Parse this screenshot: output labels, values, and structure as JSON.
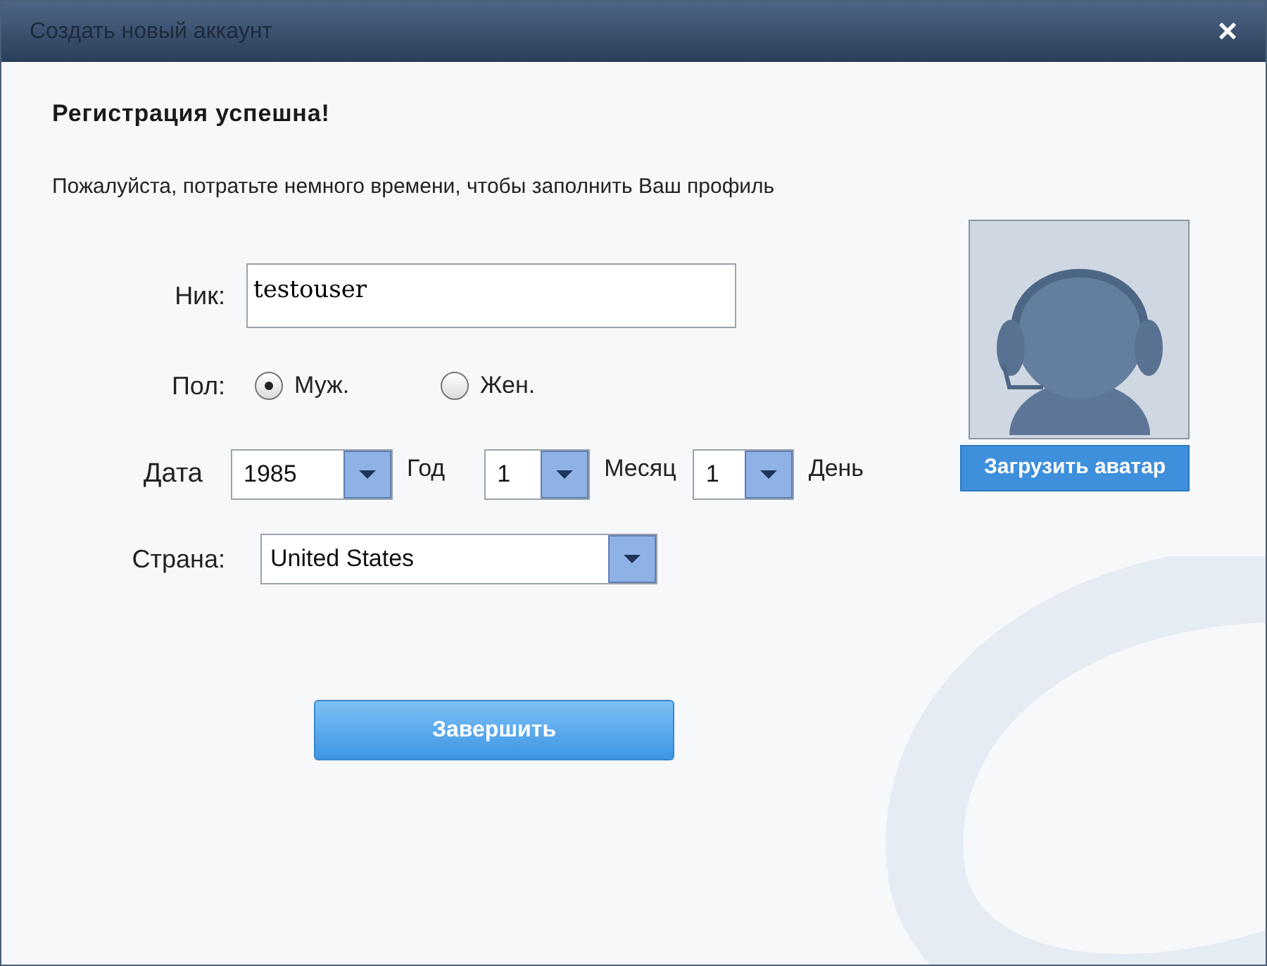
{
  "window": {
    "title": "Создать новый аккаунт",
    "close": "×"
  },
  "heading": "Регистрация успешна!",
  "subtitle": "Пожалуйста, потратьте немного времени, чтобы заполнить Ваш профиль",
  "nickname": {
    "label": "Ник:",
    "value": "testouser"
  },
  "gender": {
    "label": "Пол:",
    "options": [
      {
        "label": "Муж.",
        "selected": true
      },
      {
        "label": "Жен.",
        "selected": false
      }
    ]
  },
  "date": {
    "label": "Дата",
    "parts": [
      {
        "value": "1985",
        "unit": "Год"
      },
      {
        "value": "1",
        "unit": "Месяц"
      },
      {
        "value": "1",
        "unit": "День"
      }
    ]
  },
  "country": {
    "label": "Страна:",
    "value": "United States"
  },
  "avatar": {
    "button": "Загрузить аватар"
  },
  "finish_button": "Завершить"
}
